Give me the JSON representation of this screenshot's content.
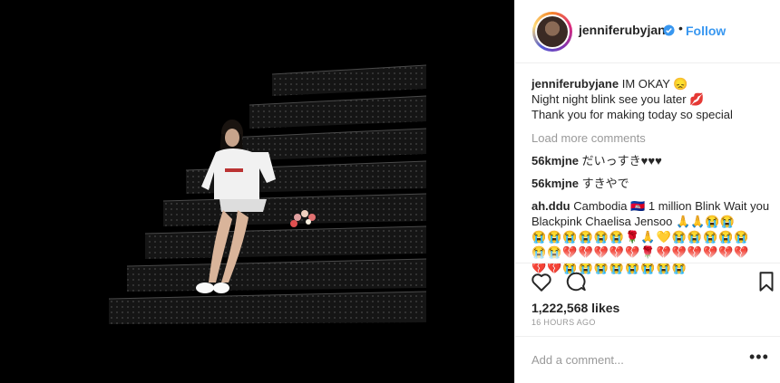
{
  "post": {
    "username": "jenniferubyjane",
    "follow_label": "Follow",
    "separator": "•"
  },
  "caption": {
    "username": "jenniferubyjane",
    "line1": "IM OKAY 😞",
    "line2": "Night night blink see you later 💋",
    "line3": "Thank you for making today so special"
  },
  "load_more": "Load more comments",
  "comments": [
    {
      "user": "56kmjne",
      "text": "だいっすき♥♥♥"
    },
    {
      "user": "56kmjne",
      "text": "すきやで"
    },
    {
      "user": "ah.ddu",
      "text": "Cambodia 🇰🇭 1 million Blink Wait you Blackpink Chaelisa Jensoo 🙏🙏😭😭"
    }
  ],
  "emoji_rows": [
    "😭😭😭😭😭😭🌹🙏💛😭😭😭😭😭",
    "😭😭💔💔💔💔💔🌹💔💔💔💔💔💔",
    "💔💔😭😭😭😭😭😭😭😭"
  ],
  "likes": "1,222,568 likes",
  "timestamp": "16 HOURS AGO",
  "add_comment_placeholder": "Add a comment...",
  "more_label": "•••",
  "colors": {
    "link": "#3897f0",
    "muted": "#999999",
    "text": "#262626"
  },
  "icons": [
    "heart-icon",
    "comment-icon",
    "bookmark-icon",
    "verified-icon"
  ]
}
